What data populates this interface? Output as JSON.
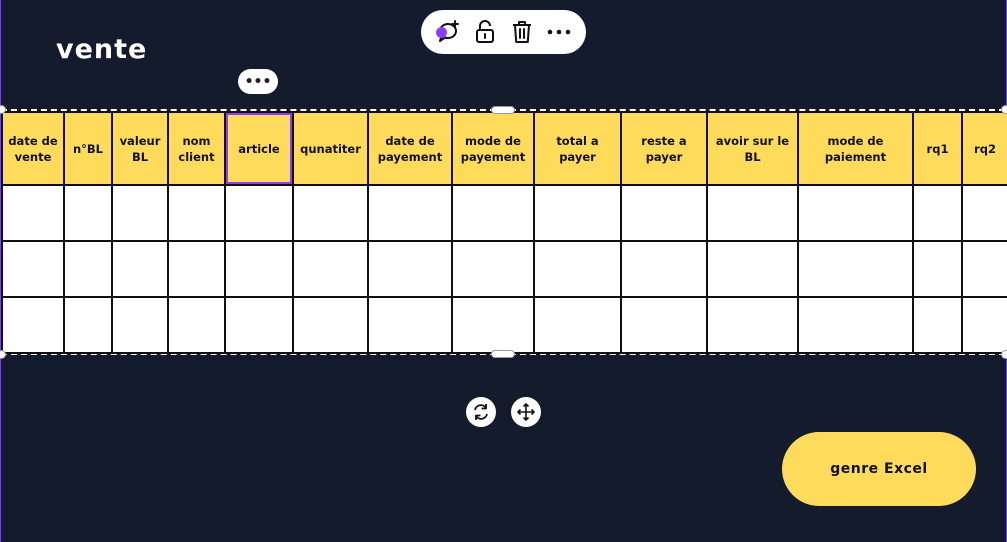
{
  "page": {
    "title": "vente"
  },
  "toolbar": {
    "icons": [
      "comment-add-icon",
      "unlock-icon",
      "trash-icon",
      "more-icon"
    ],
    "more_label": "•••"
  },
  "table_more_label": "•••",
  "table": {
    "headers": [
      "date de vente",
      "n°BL",
      "valeur BL",
      "nom client",
      "article",
      "qunatiter",
      "date de payement",
      "mode de payement",
      "total a payer",
      "reste a payer",
      "avoir sur le BL",
      "mode de paiement",
      "rq1",
      "rq2"
    ],
    "row_count": 3
  },
  "actions": {
    "excel_button": "genre Excel"
  },
  "colors": {
    "background": "#131b2c",
    "accent": "#ffdb5c",
    "selection": "#8a3ffc"
  }
}
